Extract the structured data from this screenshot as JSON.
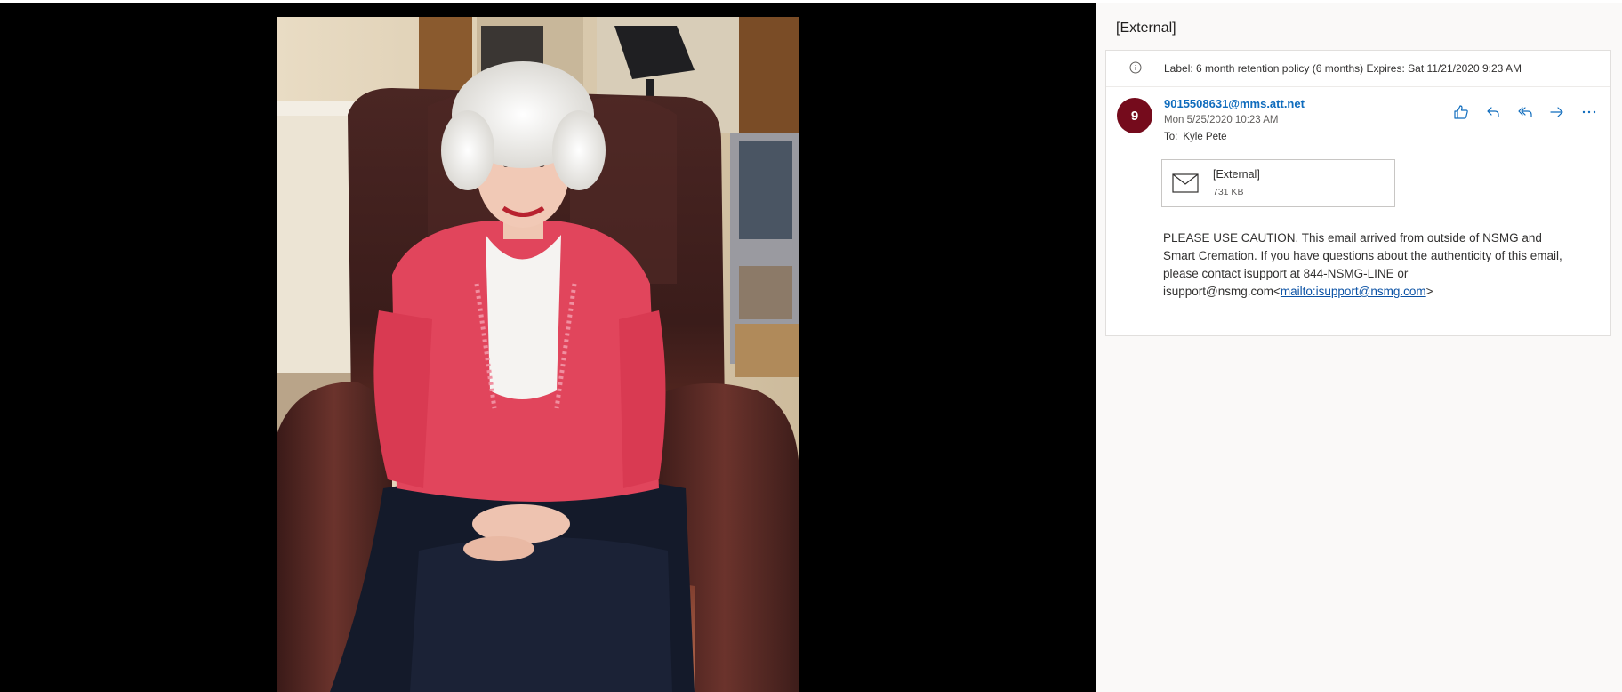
{
  "viewer": {
    "image_alt": "Photo of an elderly woman in a pink cardigan seated in a brown leather recliner"
  },
  "mail": {
    "subject": "[External]",
    "label_text": "Label: 6 month retention policy (6 months) Expires: Sat 11/21/2020 9:23 AM",
    "avatar_initial": "9",
    "avatar_color": "#750b1c",
    "sender": "9015508631@mms.att.net",
    "date": "Mon 5/25/2020 10:23 AM",
    "to_label": "To:",
    "to_name": "Kyle Pete",
    "actions": [
      {
        "name": "like",
        "icon": "thumbs-up-icon"
      },
      {
        "name": "reply",
        "icon": "reply-icon"
      },
      {
        "name": "reply-all",
        "icon": "reply-all-icon"
      },
      {
        "name": "forward",
        "icon": "forward-icon"
      },
      {
        "name": "more",
        "icon": "more-icon"
      }
    ],
    "attachment": {
      "name": "[External]",
      "size": "731 KB",
      "icon": "mail-icon"
    },
    "body": {
      "text": "PLEASE USE CAUTION. This email arrived from outside of NSMG and Smart Cremation. If you have questions about the authenticity of this email, please contact isupport at 844-NSMG-LINE or isupport@nsmg.com<",
      "link": "mailto:isupport@nsmg.com",
      "after_link": ">"
    },
    "accent_color": "#0f6cbd"
  }
}
